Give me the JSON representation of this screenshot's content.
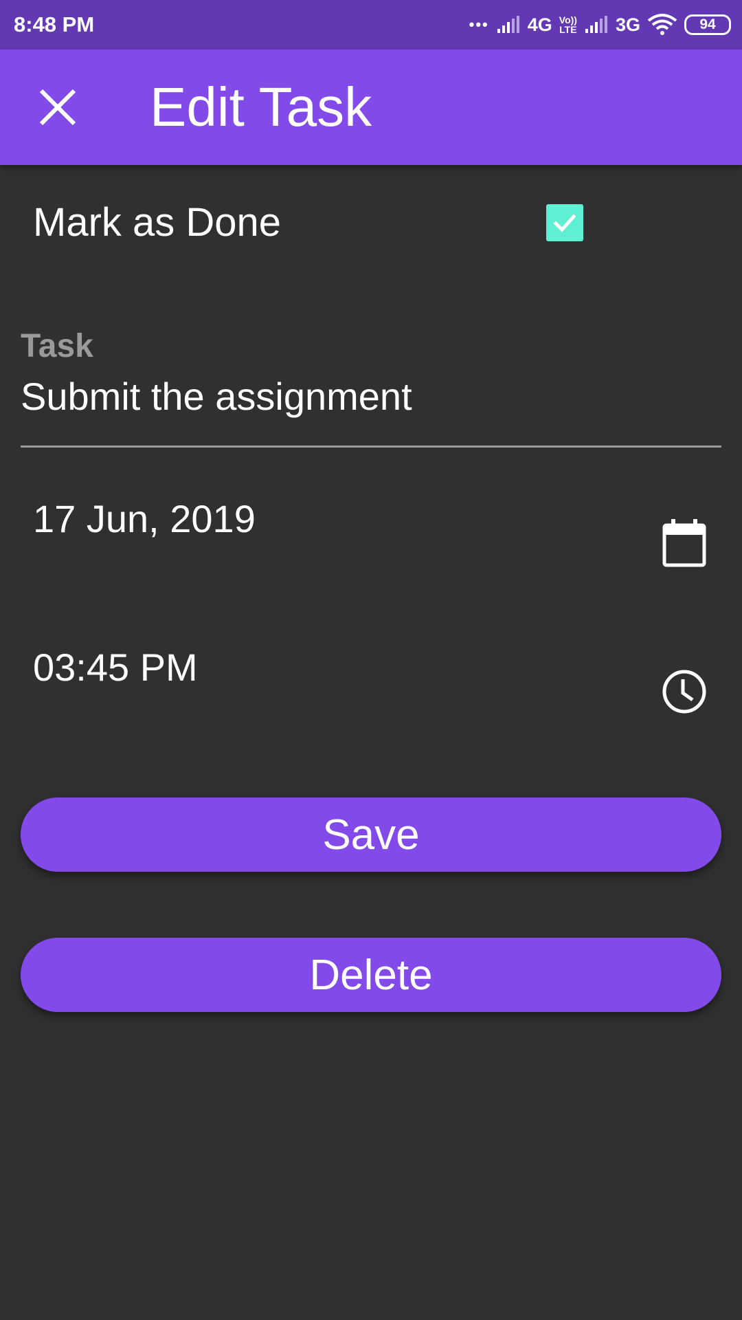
{
  "status_bar": {
    "time": "8:48 PM",
    "dots": "•••",
    "network_1": "4G",
    "volte_top": "Vo))",
    "volte_bottom": "LTE",
    "network_2": "3G",
    "battery": "94",
    "icons": [
      "signal-icon",
      "wifi-icon",
      "battery-icon"
    ]
  },
  "app_bar": {
    "title": "Edit Task",
    "close_icon": "close-icon"
  },
  "form": {
    "mark_done_label": "Mark as Done",
    "mark_done_checked": true,
    "task_label": "Task",
    "task_value": "Submit the assignment",
    "date_value": "17 Jun, 2019",
    "time_value": "03:45 PM",
    "date_icon": "calendar-icon",
    "time_icon": "clock-icon"
  },
  "buttons": {
    "save_label": "Save",
    "delete_label": "Delete"
  },
  "colors": {
    "status_bar": "#6239b3",
    "app_bar": "#824ae8",
    "background": "#303030",
    "checkbox": "#5ef0d2",
    "button": "#824ae8",
    "label_gray": "#9a9a9a"
  }
}
